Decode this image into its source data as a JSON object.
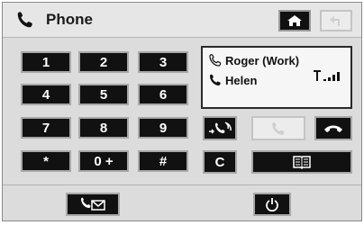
{
  "header": {
    "title": "Phone",
    "title_icon": "phone-handset-icon",
    "home_icon": "home-icon",
    "back_icon": "back-arrow-icon"
  },
  "keypad": {
    "keys": [
      {
        "label": "1"
      },
      {
        "label": "2"
      },
      {
        "label": "3"
      },
      {
        "label": "4"
      },
      {
        "label": "5"
      },
      {
        "label": "6"
      },
      {
        "label": "7"
      },
      {
        "label": "8"
      },
      {
        "label": "9"
      },
      {
        "label": "*"
      },
      {
        "label": "0 +"
      },
      {
        "label": "#"
      }
    ]
  },
  "calls": {
    "contacts": [
      {
        "name": "Roger (Work)",
        "icon": "phone-outline-icon"
      },
      {
        "name": "Helen",
        "icon": "phone-handset-icon"
      }
    ],
    "signal_icon": "signal-strength-icon"
  },
  "controls": {
    "clear_label": "C",
    "transfer_icon": "call-transfer-icon",
    "answer_icon": "call-answer-icon",
    "hangup_icon": "hang-up-icon",
    "phonebook_icon": "phonebook-icon",
    "voicemail_icon": "voicemail-icon",
    "power_icon": "power-icon"
  }
}
